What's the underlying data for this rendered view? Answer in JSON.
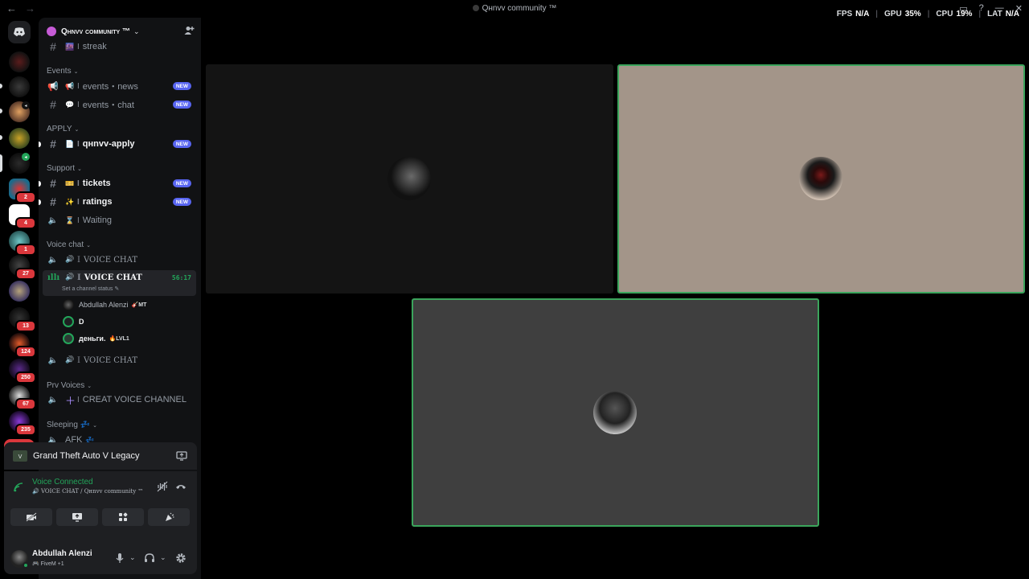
{
  "window": {
    "title": "Qнnvv community ™",
    "back_icon": "←",
    "forward_icon": "→"
  },
  "hud": {
    "fps_label": "FPS",
    "fps_value": "N/A",
    "gpu_label": "GPU",
    "gpu_value": "35%",
    "cpu_label": "CPU",
    "cpu_value": "19%",
    "lat_label": "LAT",
    "lat_value": "N/A"
  },
  "rail": {
    "badges": [
      "2",
      "4",
      "1",
      "27",
      "13",
      "124",
      "250",
      "67",
      "235"
    ],
    "new_label": "NEW"
  },
  "server": {
    "name": "Qнnvv community ™"
  },
  "channels": {
    "streak": "streak",
    "cat_events": "Events",
    "events_news": "events・news",
    "events_chat": "events・chat",
    "cat_apply": "APPLY",
    "apply": "qнnvv-apply",
    "cat_support": "Support",
    "tickets": "tickets",
    "ratings": "ratings",
    "waiting": "Waiting",
    "cat_voice": "Voice chat",
    "vc1": "VOICE CHAT",
    "vc2": "VOICE CHAT",
    "vc2_timer": "56:17",
    "vc2_status": "Set a channel status",
    "vc3": "VOICE CHAT",
    "cat_prv": "Prv Voices",
    "create": "CREAT VOICE CHANNEL",
    "cat_sleeping": "Sleeping",
    "afk": "AFK",
    "new_badge": "NEW",
    "bar": "I"
  },
  "members": [
    {
      "name": "Abdullah Alenzi",
      "tag": "MT"
    },
    {
      "name": "D",
      "tag": ""
    },
    {
      "name": "деньги.",
      "tag": "LVL1"
    }
  ],
  "activity": {
    "game": "Grand Theft Auto V Legacy"
  },
  "voice": {
    "status": "Voice Connected",
    "location": "VOICE CHAT / Qнnvv community ™"
  },
  "user": {
    "name": "Abdullah Alenzi",
    "status": "FiveM +1"
  },
  "colors": {
    "accent_green": "#23a55a",
    "badge_red": "#da373c",
    "blurple": "#5865f2"
  }
}
